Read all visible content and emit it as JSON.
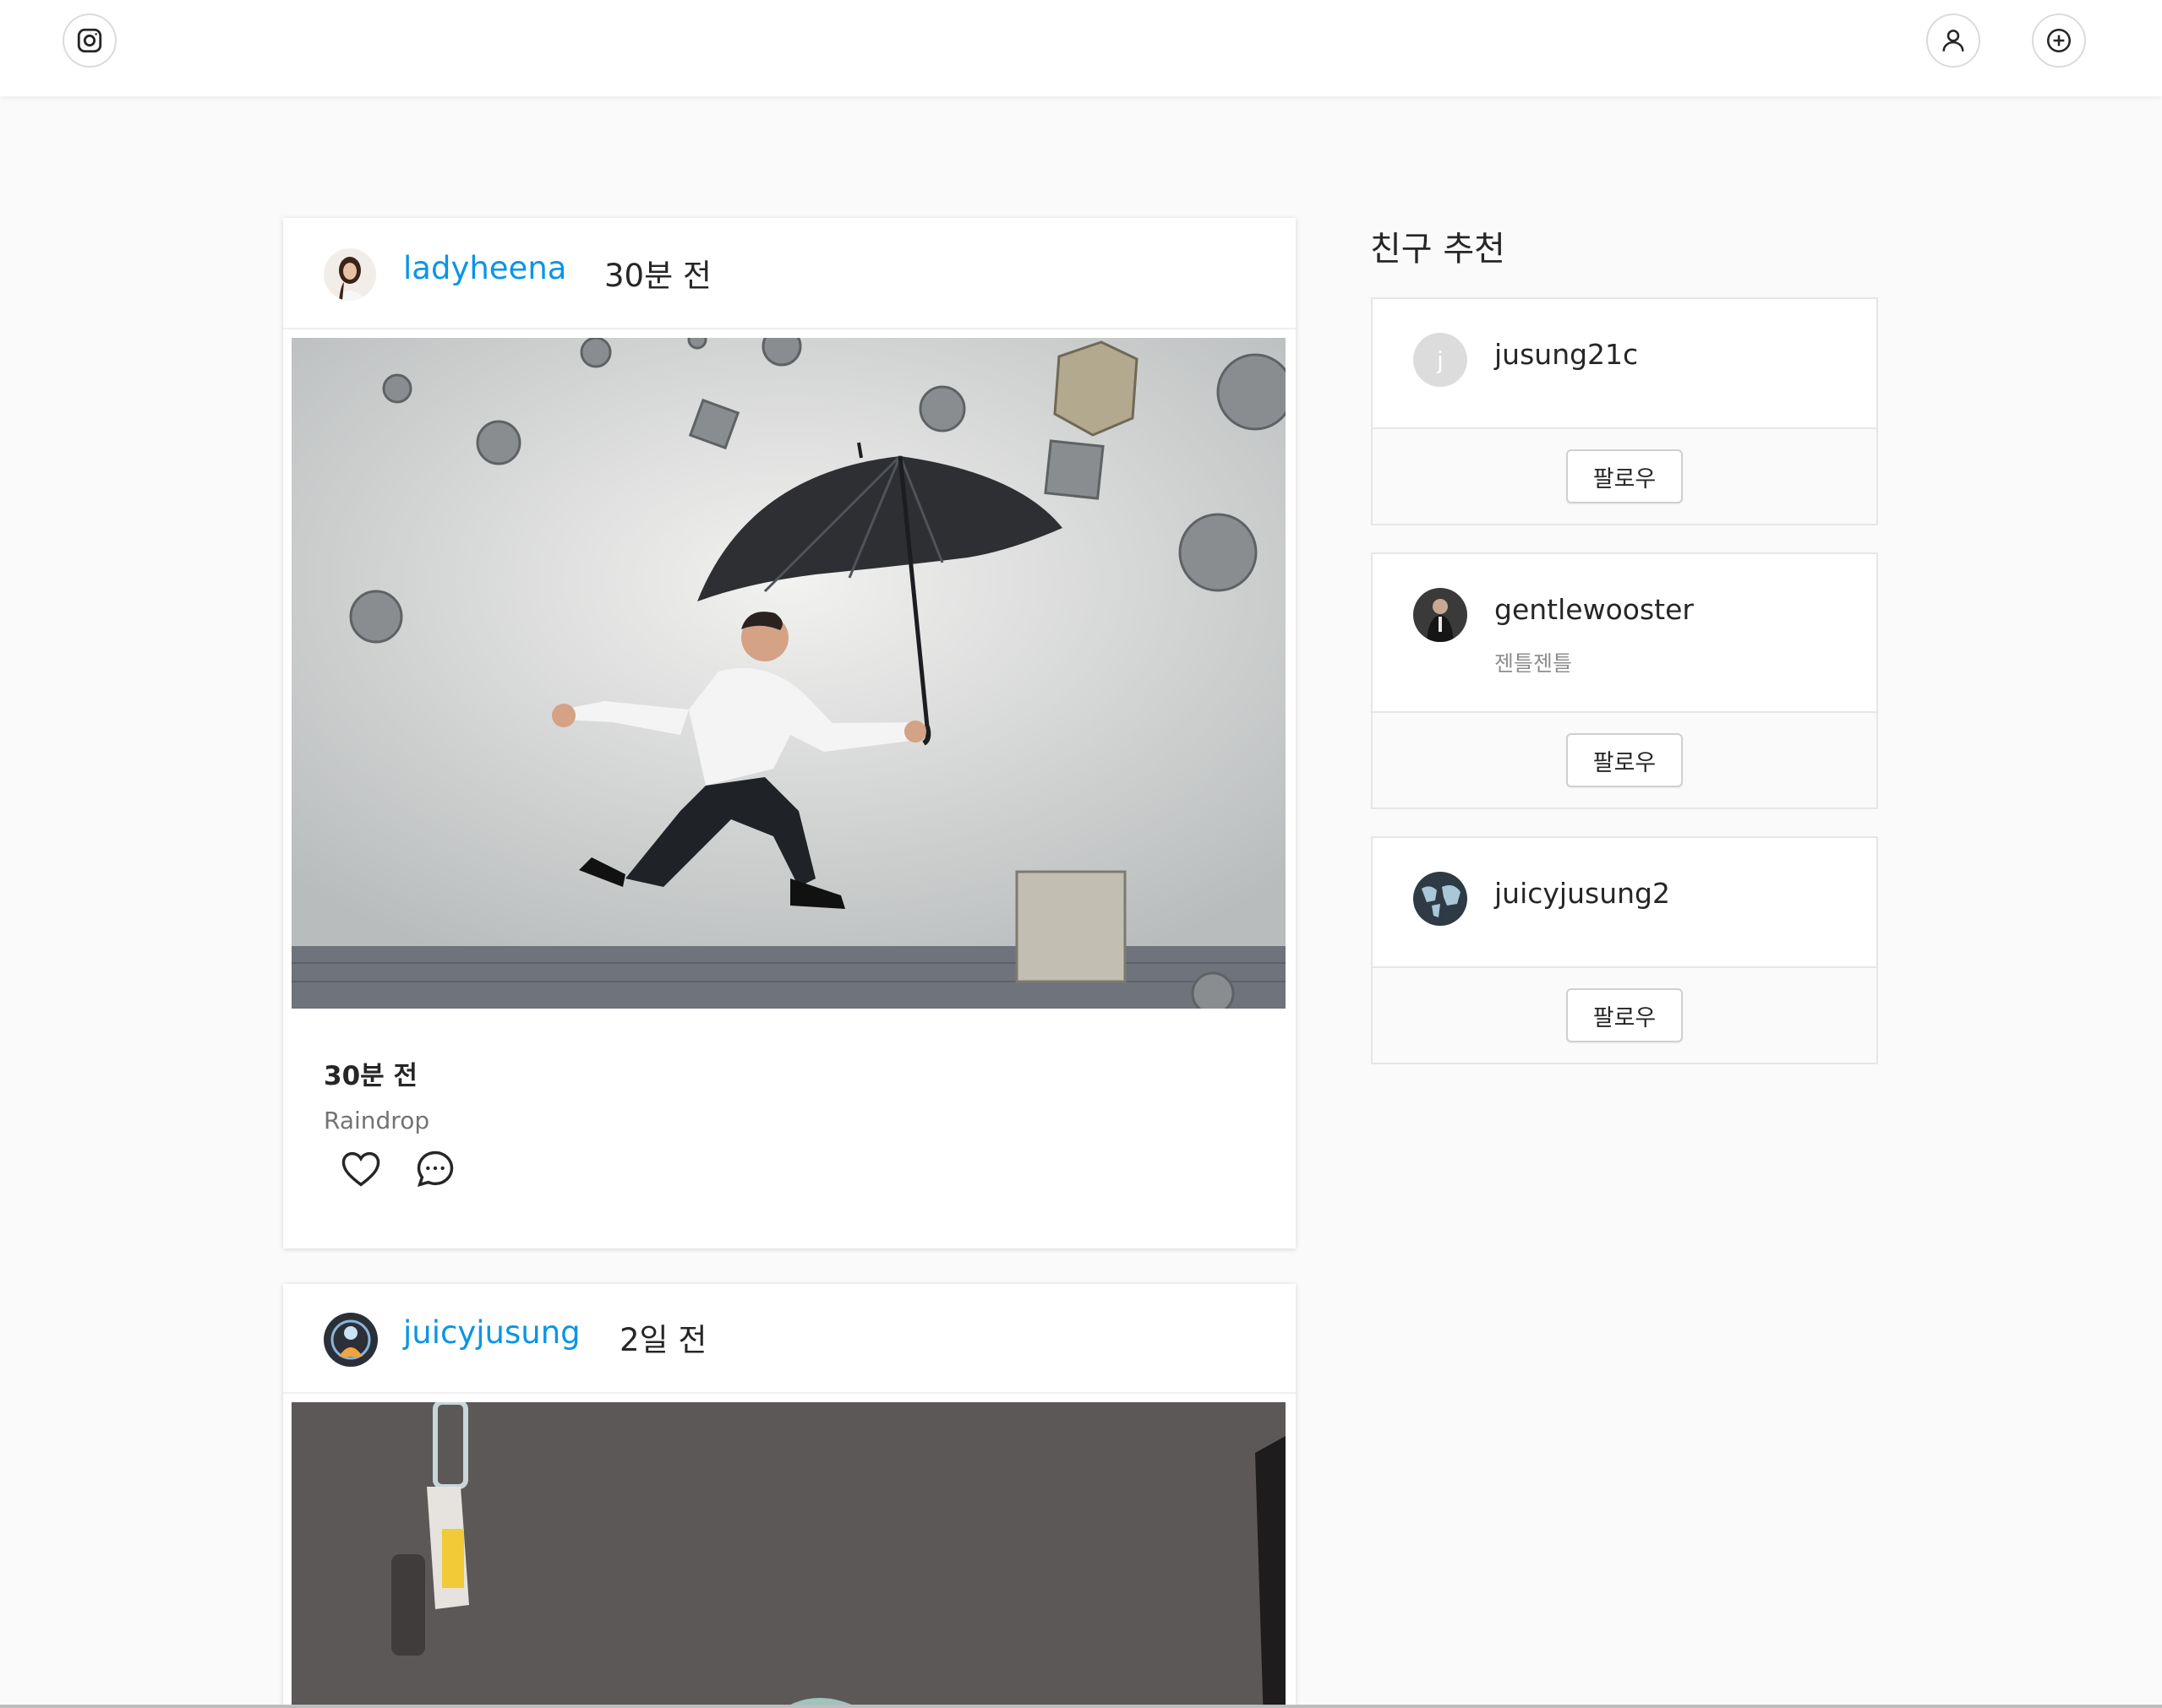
{
  "nav": {
    "logo_icon": "instagram-icon",
    "profile_icon": "user-icon",
    "add_icon": "plus-circle-icon"
  },
  "posts": [
    {
      "username": "ladyheena",
      "time": "30분 전",
      "body_time": "30분 전",
      "caption": "Raindrop",
      "avatar_icon": "user-avatar-woman",
      "image": "man-with-umbrella-photo"
    },
    {
      "username": "juicyjusung",
      "time": "2일 전",
      "image": "hanging-tag-photo"
    }
  ],
  "actions": {
    "like_icon": "heart-icon",
    "comment_icon": "comment-icon"
  },
  "suggestions": {
    "title": "친구 추천",
    "items": [
      {
        "avatar_letter": "j",
        "name": "jusung21c",
        "subtitle": "",
        "button": "팔로우"
      },
      {
        "name": "gentlewooster",
        "subtitle": "젠틀젠틀",
        "button": "팔로우"
      },
      {
        "name": "juicyjusung2",
        "subtitle": "",
        "button": "팔로우"
      }
    ]
  }
}
